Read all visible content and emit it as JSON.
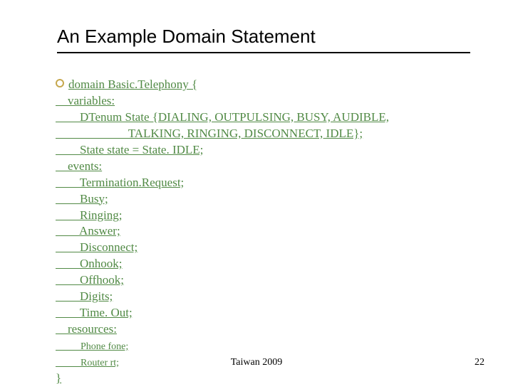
{
  "title": "An Example Domain Statement",
  "lines": [
    "domain Basic.Telephony {",
    "    variables:",
    "        DTenum State {DIALING, OUTPULSING, BUSY, AUDIBLE,",
    "                        TALKING, RINGING, DISCONNECT, IDLE};",
    "        State state = State. IDLE;",
    "    events:",
    "        Termination.Request;",
    "        Busy;",
    "        Ringing;",
    "        Answer;",
    "        Disconnect;",
    "        Onhook;",
    "        Offhook;",
    "        Digits;",
    "        Time. Out;",
    "    resources:"
  ],
  "resource_lines": [
    "          Phone fone;",
    "          Router rt;"
  ],
  "close_brace": "}",
  "footer_center": "Taiwan 2009",
  "footer_right": "22"
}
